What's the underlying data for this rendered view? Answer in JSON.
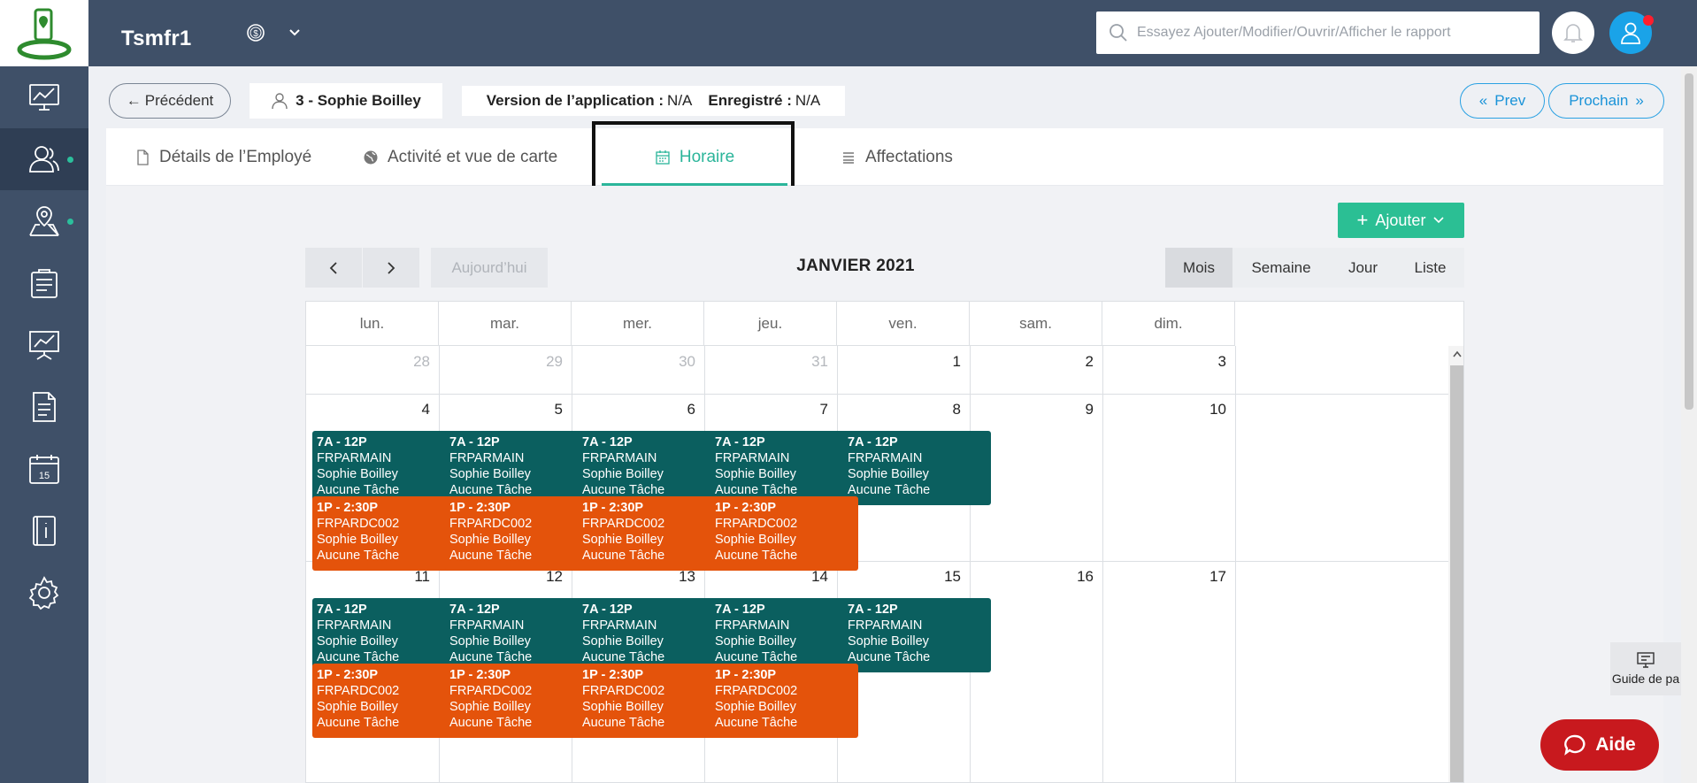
{
  "header": {
    "app_name": "Tsmfr1",
    "search_placeholder": "Essayez Ajouter/Modifier/Ouvrir/Afficher le rapport"
  },
  "sidebar": {
    "items": [
      {
        "icon": "dashboard-icon",
        "active": false
      },
      {
        "icon": "employees-icon",
        "active": true
      },
      {
        "icon": "map-location-icon",
        "active": false
      },
      {
        "icon": "clipboard-icon",
        "active": false
      },
      {
        "icon": "presentation-chart-icon",
        "active": false
      },
      {
        "icon": "document-icon",
        "active": false
      },
      {
        "icon": "calendar-icon",
        "active": false
      },
      {
        "icon": "info-book-icon",
        "active": false
      },
      {
        "icon": "gear-icon",
        "active": false
      }
    ]
  },
  "subheader": {
    "back_label": "Précédent",
    "employee": "3 - Sophie Boilley",
    "version_label": "Version de l’application :",
    "version_value": "N/A",
    "registered_label": "Enregistré :",
    "registered_value": "N/A",
    "prev_label": "Prev",
    "next_label": "Prochain"
  },
  "tabs": [
    {
      "label": "Détails de l’Employé",
      "active": false
    },
    {
      "label": "Activité et vue de carte",
      "active": false
    },
    {
      "label": "Horaire",
      "active": true
    },
    {
      "label": "Affectations",
      "active": false
    }
  ],
  "toolbar": {
    "add_label": "Ajouter",
    "today_label": "Aujourd’hui",
    "title": "JANVIER 2021",
    "views": [
      "Mois",
      "Semaine",
      "Jour",
      "Liste"
    ],
    "active_view": "Mois"
  },
  "calendar": {
    "weekdays": [
      "lun.",
      "mar.",
      "mer.",
      "jeu.",
      "ven.",
      "sam.",
      "dim."
    ],
    "weeks": [
      [
        {
          "d": "28",
          "other": true
        },
        {
          "d": "29",
          "other": true
        },
        {
          "d": "30",
          "other": true
        },
        {
          "d": "31",
          "other": true
        },
        {
          "d": "1"
        },
        {
          "d": "2"
        },
        {
          "d": "3"
        }
      ],
      [
        {
          "d": "4"
        },
        {
          "d": "5"
        },
        {
          "d": "6"
        },
        {
          "d": "7"
        },
        {
          "d": "8"
        },
        {
          "d": "9"
        },
        {
          "d": "10"
        }
      ],
      [
        {
          "d": "11"
        },
        {
          "d": "12"
        },
        {
          "d": "13"
        },
        {
          "d": "14"
        },
        {
          "d": "15"
        },
        {
          "d": "16"
        },
        {
          "d": "17"
        }
      ]
    ],
    "events": [
      {
        "week": 1,
        "day": 0,
        "kind": "am",
        "time": "7A - 12P",
        "location": "FRPARMAIN",
        "employee": "Sophie Boilley",
        "task": "Aucune Tâche"
      },
      {
        "week": 1,
        "day": 1,
        "kind": "am",
        "time": "7A - 12P",
        "location": "FRPARMAIN",
        "employee": "Sophie Boilley",
        "task": "Aucune Tâche"
      },
      {
        "week": 1,
        "day": 2,
        "kind": "am",
        "time": "7A - 12P",
        "location": "FRPARMAIN",
        "employee": "Sophie Boilley",
        "task": "Aucune Tâche"
      },
      {
        "week": 1,
        "day": 3,
        "kind": "am",
        "time": "7A - 12P",
        "location": "FRPARMAIN",
        "employee": "Sophie Boilley",
        "task": "Aucune Tâche"
      },
      {
        "week": 1,
        "day": 4,
        "kind": "am",
        "time": "7A - 12P",
        "location": "FRPARMAIN",
        "employee": "Sophie Boilley",
        "task": "Aucune Tâche"
      },
      {
        "week": 1,
        "day": 0,
        "kind": "pm",
        "time": "1P - 2:30P",
        "location": "FRPARDC002",
        "employee": "Sophie Boilley",
        "task": "Aucune Tâche"
      },
      {
        "week": 1,
        "day": 1,
        "kind": "pm",
        "time": "1P - 2:30P",
        "location": "FRPARDC002",
        "employee": "Sophie Boilley",
        "task": "Aucune Tâche"
      },
      {
        "week": 1,
        "day": 2,
        "kind": "pm",
        "time": "1P - 2:30P",
        "location": "FRPARDC002",
        "employee": "Sophie Boilley",
        "task": "Aucune Tâche"
      },
      {
        "week": 1,
        "day": 3,
        "kind": "pm",
        "time": "1P - 2:30P",
        "location": "FRPARDC002",
        "employee": "Sophie Boilley",
        "task": "Aucune Tâche"
      },
      {
        "week": 2,
        "day": 0,
        "kind": "am",
        "time": "7A - 12P",
        "location": "FRPARMAIN",
        "employee": "Sophie Boilley",
        "task": "Aucune Tâche"
      },
      {
        "week": 2,
        "day": 1,
        "kind": "am",
        "time": "7A - 12P",
        "location": "FRPARMAIN",
        "employee": "Sophie Boilley",
        "task": "Aucune Tâche"
      },
      {
        "week": 2,
        "day": 2,
        "kind": "am",
        "time": "7A - 12P",
        "location": "FRPARMAIN",
        "employee": "Sophie Boilley",
        "task": "Aucune Tâche"
      },
      {
        "week": 2,
        "day": 3,
        "kind": "am",
        "time": "7A - 12P",
        "location": "FRPARMAIN",
        "employee": "Sophie Boilley",
        "task": "Aucune Tâche"
      },
      {
        "week": 2,
        "day": 4,
        "kind": "am",
        "time": "7A - 12P",
        "location": "FRPARMAIN",
        "employee": "Sophie Boilley",
        "task": "Aucune Tâche"
      },
      {
        "week": 2,
        "day": 0,
        "kind": "pm",
        "time": "1P - 2:30P",
        "location": "FRPARDC002",
        "employee": "Sophie Boilley",
        "task": "Aucune Tâche"
      },
      {
        "week": 2,
        "day": 1,
        "kind": "pm",
        "time": "1P - 2:30P",
        "location": "FRPARDC002",
        "employee": "Sophie Boilley",
        "task": "Aucune Tâche"
      },
      {
        "week": 2,
        "day": 2,
        "kind": "pm",
        "time": "1P - 2:30P",
        "location": "FRPARDC002",
        "employee": "Sophie Boilley",
        "task": "Aucune Tâche"
      },
      {
        "week": 2,
        "day": 3,
        "kind": "pm",
        "time": "1P - 2:30P",
        "location": "FRPARDC002",
        "employee": "Sophie Boilley",
        "task": "Aucune Tâche"
      }
    ]
  },
  "widgets": {
    "guide_label": "Guide de pa",
    "help_label": "Aide"
  },
  "colors": {
    "sidebar": "#3f5068",
    "accent": "#2bb59a",
    "event_am": "#0b5f5f",
    "event_pm": "#e4530b",
    "help": "#c8191e",
    "link": "#1a93d8"
  }
}
